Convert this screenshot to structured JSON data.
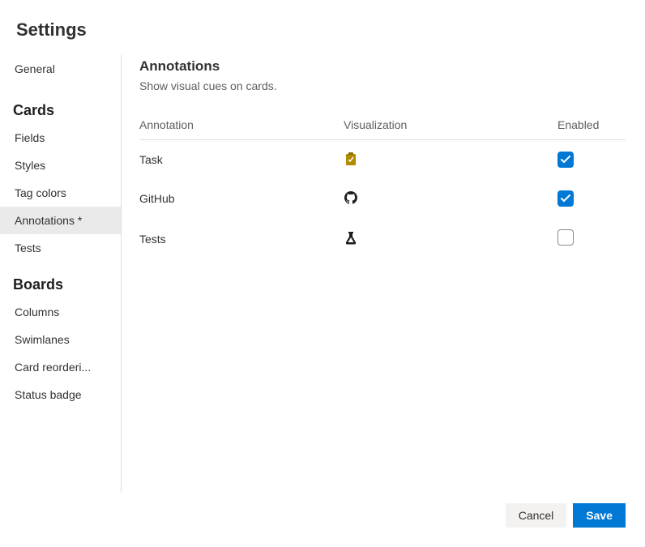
{
  "title": "Settings",
  "sidebar": {
    "general": "General",
    "cards_heading": "Cards",
    "cards": {
      "fields": "Fields",
      "styles": "Styles",
      "tag_colors": "Tag colors",
      "annotations": "Annotations *",
      "tests": "Tests"
    },
    "boards_heading": "Boards",
    "boards": {
      "columns": "Columns",
      "swimlanes": "Swimlanes",
      "card_reordering": "Card reorderi...",
      "status_badge": "Status badge"
    }
  },
  "main": {
    "section_title": "Annotations",
    "section_subtitle": "Show visual cues on cards.",
    "columns": {
      "annotation": "Annotation",
      "visualization": "Visualization",
      "enabled": "Enabled"
    },
    "rows": {
      "task": {
        "label": "Task",
        "icon": "clipboard-icon",
        "enabled": true
      },
      "github": {
        "label": "GitHub",
        "icon": "github-icon",
        "enabled": true
      },
      "tests": {
        "label": "Tests",
        "icon": "beaker-icon",
        "enabled": false
      }
    }
  },
  "footer": {
    "cancel": "Cancel",
    "save": "Save"
  }
}
